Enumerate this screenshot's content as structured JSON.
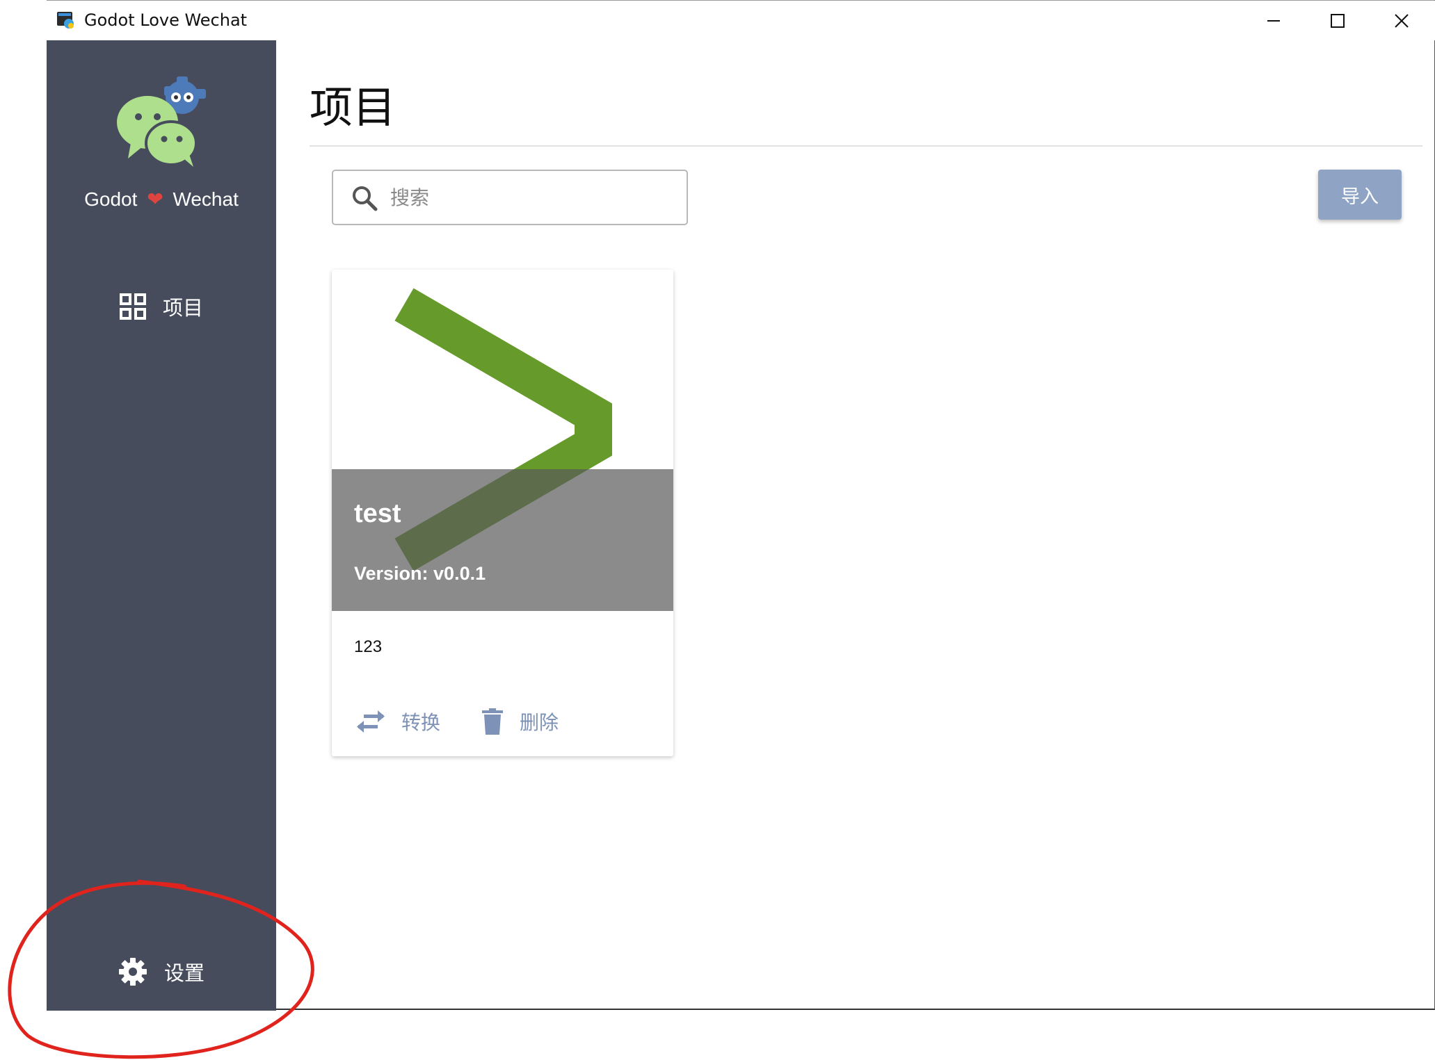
{
  "window": {
    "title": "Godot Love Wechat"
  },
  "sidebar": {
    "brand_left": "Godot",
    "brand_heart": "❤",
    "brand_right": "Wechat",
    "items": [
      {
        "label": "项目",
        "icon": "grid-icon"
      },
      {
        "label": "设置",
        "icon": "gear-icon"
      }
    ]
  },
  "main": {
    "title": "项目",
    "search_placeholder": "搜索",
    "import_label": "导入"
  },
  "projects": [
    {
      "name": "test",
      "version": "Version: v0.0.1",
      "description": "123",
      "actions": [
        {
          "label": "转换",
          "icon": "swap-icon"
        },
        {
          "label": "删除",
          "icon": "trash-icon"
        }
      ]
    }
  ],
  "colors": {
    "sidebar_bg": "#474c5d",
    "accent": "#8fa4c5",
    "action_text": "#7d92b6",
    "thumbnail_green": "#669a2a",
    "annotation_red": "#e0231c"
  }
}
